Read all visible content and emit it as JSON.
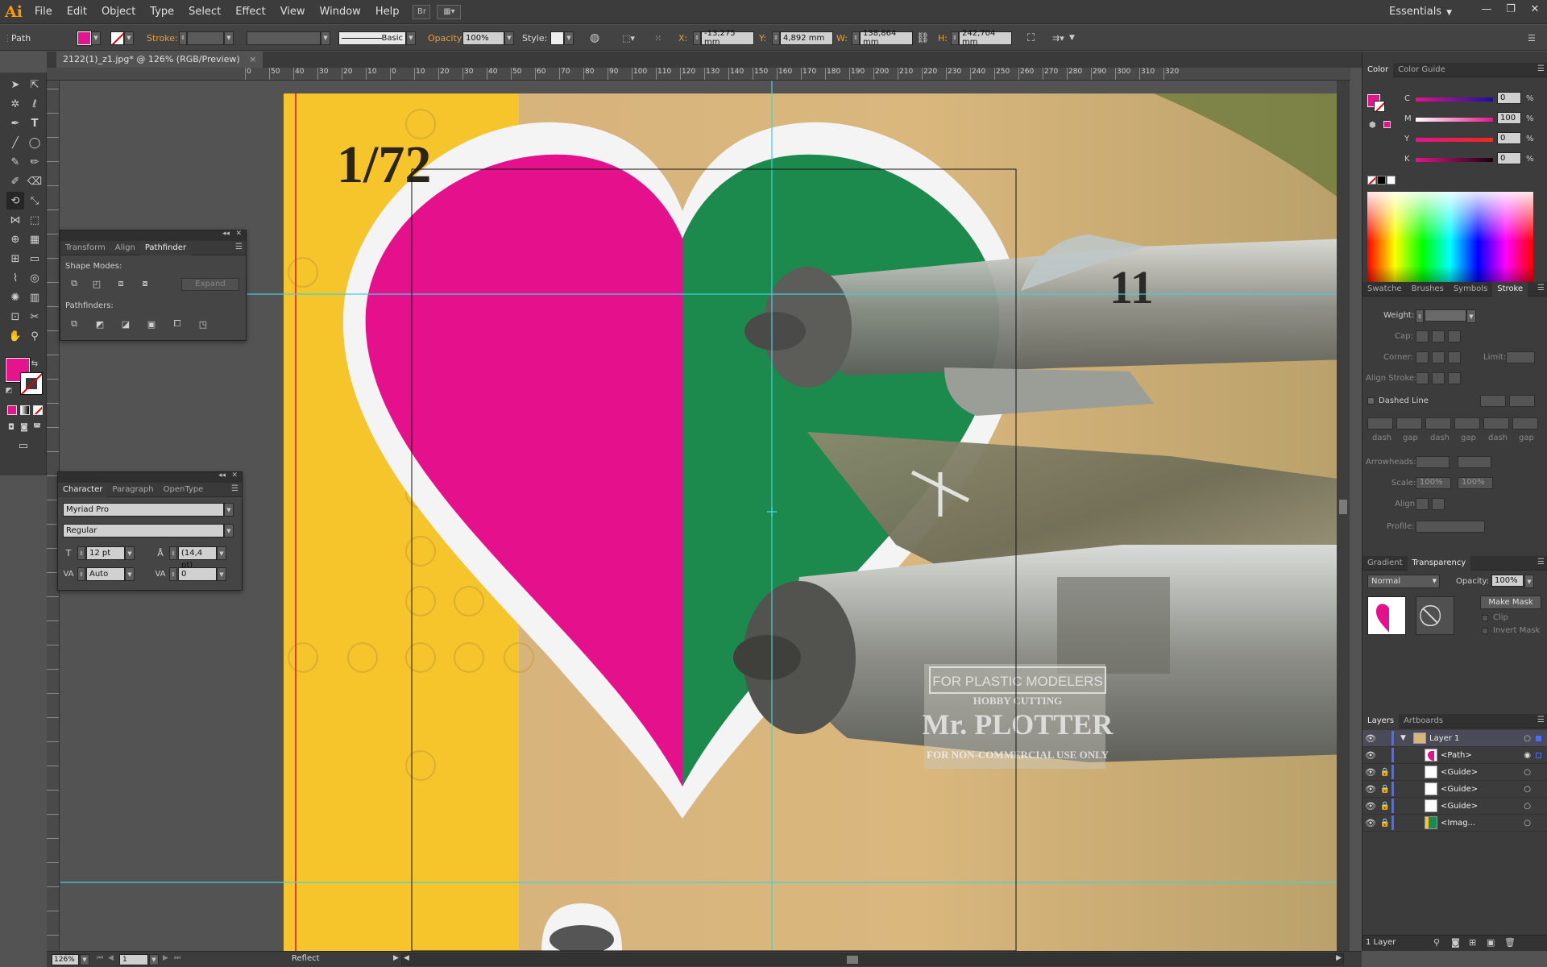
{
  "app": {
    "logo": "Ai",
    "menus": [
      "File",
      "Edit",
      "Object",
      "Type",
      "Select",
      "Effect",
      "View",
      "Window",
      "Help"
    ],
    "workspace": "Essentials",
    "window_controls": [
      "—",
      "❐",
      "✕"
    ]
  },
  "control_bar": {
    "selection_type": "Path",
    "fill_color": "#e4148c",
    "stroke_label": "Stroke:",
    "brush_profile": "Basic",
    "opacity_label": "Opacity:",
    "opacity_value": "100%",
    "style_label": "Style:",
    "x_label": "X:",
    "x_value": "-13,275 mm",
    "y_label": "Y:",
    "y_value": "4,892 mm",
    "w_label": "W:",
    "w_value": "138,864 mm",
    "h_label": "H:",
    "h_value": "242,704 mm"
  },
  "document": {
    "tab_title": "2122(1)_z1.jpg* @ 126% (RGB/Preview)",
    "tab_close": "×",
    "ruler_top": [
      "0",
      "50",
      "40",
      "30",
      "20",
      "10",
      "0",
      "10",
      "20",
      "30",
      "40",
      "50",
      "60",
      "70",
      "80",
      "90",
      "100",
      "110",
      "120",
      "130",
      "140",
      "150",
      "160",
      "170",
      "180",
      "190",
      "200",
      "210",
      "220",
      "230",
      "240",
      "250",
      "260",
      "270",
      "280",
      "290",
      "300",
      "310",
      "320"
    ]
  },
  "artwork": {
    "scale_text": "1/72",
    "watermark": {
      "line1": "FOR PLASTIC MODELERS",
      "line2": "HOBBY CUTTING",
      "line3": "Mr. PLOTTER",
      "line4": "FOR NON-COMMERCIAL USE ONLY"
    },
    "plane_number": "11",
    "colors": {
      "yellow": "#f6c42b",
      "tan": "#d8b57a",
      "magenta": "#e4108c",
      "green": "#1b8a4c",
      "white": "#f4f4f4",
      "guide": "#41d0e0"
    }
  },
  "pathfinder_panel": {
    "tabs": [
      "Transform",
      "Align",
      "Pathfinder"
    ],
    "active_tab": "Pathfinder",
    "shape_modes_label": "Shape Modes:",
    "expand_label": "Expand",
    "pathfinders_label": "Pathfinders:"
  },
  "character_panel": {
    "tabs": [
      "Character",
      "Paragraph",
      "OpenType"
    ],
    "active_tab": "Character",
    "font_family": "Myriad Pro",
    "font_style": "Regular",
    "font_size": "12 pt",
    "leading": "(14,4 pt)",
    "kerning": "Auto",
    "tracking": "0"
  },
  "color_panel": {
    "tabs": [
      "Color",
      "Color Guide"
    ],
    "active_tab": "Color",
    "channels": [
      {
        "label": "C",
        "value": "0"
      },
      {
        "label": "M",
        "value": "100"
      },
      {
        "label": "Y",
        "value": "0"
      },
      {
        "label": "K",
        "value": "0"
      }
    ],
    "percent": "%"
  },
  "stroke_panel": {
    "tabs": [
      "Swatche",
      "Brushes",
      "Symbols",
      "Stroke"
    ],
    "active_tab": "Stroke",
    "weight_label": "Weight:",
    "cap_label": "Cap:",
    "corner_label": "Corner:",
    "limit_label": "Limit:",
    "align_label": "Align Stroke:",
    "dashed_label": "Dashed Line",
    "dash_labels": [
      "dash",
      "gap",
      "dash",
      "gap",
      "dash",
      "gap"
    ],
    "arrowheads_label": "Arrowheads:",
    "scale_label": "Scale:",
    "scale_1": "100%",
    "scale_2": "100%",
    "align_arrow_label": "Align:",
    "profile_label": "Profile:"
  },
  "transparency_panel": {
    "tabs": [
      "Gradient",
      "Transparency"
    ],
    "active_tab": "Transparency",
    "blend_mode": "Normal",
    "opacity_label": "Opacity:",
    "opacity_value": "100%",
    "make_mask_label": "Make Mask",
    "clip_label": "Clip",
    "invert_label": "Invert Mask"
  },
  "layers_panel": {
    "tabs": [
      "Layers",
      "Artboards"
    ],
    "active_tab": "Layers",
    "rows": [
      {
        "name": "Layer 1",
        "locked": false,
        "indent": 0
      },
      {
        "name": "<Path>",
        "locked": false,
        "indent": 1
      },
      {
        "name": "<Guide>",
        "locked": true,
        "indent": 1
      },
      {
        "name": "<Guide>",
        "locked": true,
        "indent": 1
      },
      {
        "name": "<Guide>",
        "locked": true,
        "indent": 1
      },
      {
        "name": "<Imag...",
        "locked": true,
        "indent": 1
      }
    ],
    "footer": "1 Layer"
  },
  "status_bar": {
    "zoom": "126%",
    "artboard": "1",
    "tool": "Reflect"
  }
}
